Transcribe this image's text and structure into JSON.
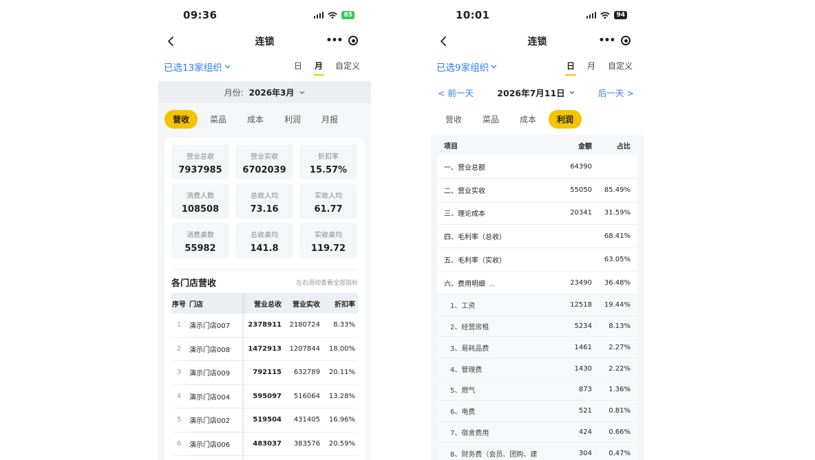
{
  "left": {
    "status": {
      "time": "09:36",
      "battery": "85"
    },
    "nav": {
      "title": "连锁"
    },
    "org_select": "已选13家组织",
    "period_tabs": [
      "日",
      "月",
      "自定义"
    ],
    "month_label": "月份:",
    "month_value": "2026年3月",
    "seg_tabs": [
      "营收",
      "菜品",
      "成本",
      "利润",
      "月报"
    ],
    "kpis": [
      {
        "label": "营业总收",
        "value": "7937985"
      },
      {
        "label": "营业实收",
        "value": "6702039"
      },
      {
        "label": "折扣率",
        "value": "15.57%"
      },
      {
        "label": "消费人数",
        "value": "108508"
      },
      {
        "label": "总收人均",
        "value": "73.16"
      },
      {
        "label": "实收人均",
        "value": "61.77"
      },
      {
        "label": "消费桌数",
        "value": "55982"
      },
      {
        "label": "总收桌均",
        "value": "141.8"
      },
      {
        "label": "实收桌均",
        "value": "119.72"
      }
    ],
    "section": {
      "title": "各门店营收",
      "hint": "左右滑动查看全部指标"
    },
    "table_headers": {
      "idx": "序号",
      "name": "门店",
      "total": "营业总收",
      "real": "营业实收",
      "rate": "折扣率"
    },
    "rows": [
      {
        "idx": "1",
        "name": "演示门店007",
        "total": "2378911",
        "real": "2180724",
        "rate": "8.33%"
      },
      {
        "idx": "2",
        "name": "演示门店008",
        "total": "1472913",
        "real": "1207844",
        "rate": "18.00%"
      },
      {
        "idx": "3",
        "name": "演示门店009",
        "total": "792115",
        "real": "632789",
        "rate": "20.11%"
      },
      {
        "idx": "4",
        "name": "演示门店004",
        "total": "595097",
        "real": "516064",
        "rate": "13.28%"
      },
      {
        "idx": "5",
        "name": "演示门店002",
        "total": "519504",
        "real": "431405",
        "rate": "16.96%"
      },
      {
        "idx": "6",
        "name": "演示门店006",
        "total": "483037",
        "real": "383576",
        "rate": "20.59%"
      }
    ]
  },
  "right": {
    "status": {
      "time": "10:01",
      "battery": "94"
    },
    "nav": {
      "title": "连锁"
    },
    "org_select": "已选9家组织",
    "period_tabs": [
      "日",
      "月",
      "自定义"
    ],
    "prev_day": "< 前一天",
    "date_value": "2026年7月11日",
    "next_day": "后一天 >",
    "seg_tabs": [
      "营收",
      "菜品",
      "成本",
      "利润"
    ],
    "table_headers": {
      "item": "项目",
      "amount": "金额",
      "pct": "占比"
    },
    "rows": [
      {
        "name": "一、营业总额",
        "amount": "64390",
        "pct": ""
      },
      {
        "name": "二、营业实收",
        "amount": "55050",
        "pct": "85.49%"
      },
      {
        "name": "三、理论成本",
        "amount": "20341",
        "pct": "31.59%"
      },
      {
        "name": "四、毛利率（总收）",
        "amount": "",
        "pct": "68.41%"
      },
      {
        "name": "五、毛利率（实收）",
        "amount": "",
        "pct": "63.05%"
      },
      {
        "name": "六、费用明细",
        "amount": "23490",
        "pct": "36.48%"
      }
    ],
    "sub_rows": [
      {
        "name": "1、工资",
        "amount": "12518",
        "pct": "19.44%"
      },
      {
        "name": "2、经营房租",
        "amount": "5234",
        "pct": "8.13%"
      },
      {
        "name": "3、易耗品费",
        "amount": "1461",
        "pct": "2.27%"
      },
      {
        "name": "4、管理费",
        "amount": "1430",
        "pct": "2.22%"
      },
      {
        "name": "5、燃气",
        "amount": "873",
        "pct": "1.36%"
      },
      {
        "name": "6、电费",
        "amount": "521",
        "pct": "0.81%"
      },
      {
        "name": "7、宿舍费用",
        "amount": "424",
        "pct": "0.66%"
      },
      {
        "name": "8、财务费（会员、团购、建",
        "amount": "304",
        "pct": "0.47%"
      }
    ]
  }
}
